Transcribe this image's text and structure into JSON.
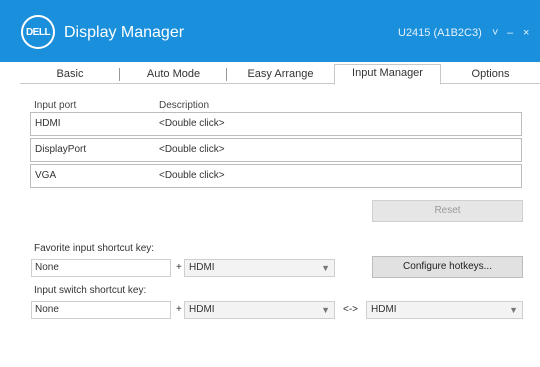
{
  "titlebar": {
    "logo": "DELL",
    "title": "Display Manager",
    "user_text": "U2415 (A1B2C3)",
    "icons": [
      "chevron-down-icon",
      "minimize-icon",
      "close-icon"
    ],
    "icon_glyphs": [
      "˅",
      "–",
      "×"
    ]
  },
  "tabs": [
    {
      "label": "Basic",
      "active": false
    },
    {
      "label": "Auto Mode",
      "active": false
    },
    {
      "label": "Easy Arrange",
      "active": false
    },
    {
      "label": "Input Manager",
      "active": true
    },
    {
      "label": "Options",
      "active": false
    }
  ],
  "inputs": {
    "headers": [
      "Input port",
      "Description"
    ],
    "rows": [
      {
        "port": "HDMI",
        "description": "<Double click>"
      },
      {
        "port": "DisplayPort",
        "description": "<Double click>"
      },
      {
        "port": "VGA",
        "description": "<Double click>"
      }
    ]
  },
  "buttons": {
    "reset": "Reset",
    "configure": "Configure hotkeys..."
  },
  "favorite": {
    "label": "Favorite input shortcut key:",
    "key": "None",
    "plus": "+",
    "input": "HDMI"
  },
  "switch": {
    "label": "Input switch shortcut key:",
    "key": "None",
    "plus": "+",
    "input1": "HDMI",
    "separator": "<->",
    "input2": "HDMI"
  },
  "colors": {
    "titlebar": "#1a8fdc",
    "active_tab_border": "#c9c9c9"
  }
}
